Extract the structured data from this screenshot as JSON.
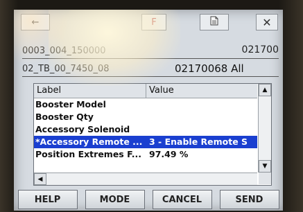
{
  "toolbar": {
    "back_icon": "back-arrow-icon",
    "mid_text": "F",
    "doc_icon": "document-icon",
    "close_icon": "close-icon"
  },
  "header": {
    "line1_left": "0003_004_150000",
    "line1_right": "021700",
    "line2_left": "02_TB_00_7450_08",
    "line2_right": "02170068 All"
  },
  "grid": {
    "columns": [
      "Label",
      "Value"
    ],
    "rows": [
      {
        "label": "Booster Model",
        "value": ""
      },
      {
        "label": "Booster Qty",
        "value": ""
      },
      {
        "label": "Accessory Solenoid",
        "value": ""
      },
      {
        "label": "*Accessory Remote ...",
        "value": "3 - Enable Remote S",
        "selected": true
      },
      {
        "label": "Position Extremes F...",
        "value": "97.49 %"
      }
    ]
  },
  "buttons": {
    "help": "HELP",
    "mode": "MODE",
    "cancel": "CANCEL",
    "send": "SEND"
  },
  "colors": {
    "selection": "#1a3fd0",
    "screen_bg": "#d6dbe1"
  }
}
